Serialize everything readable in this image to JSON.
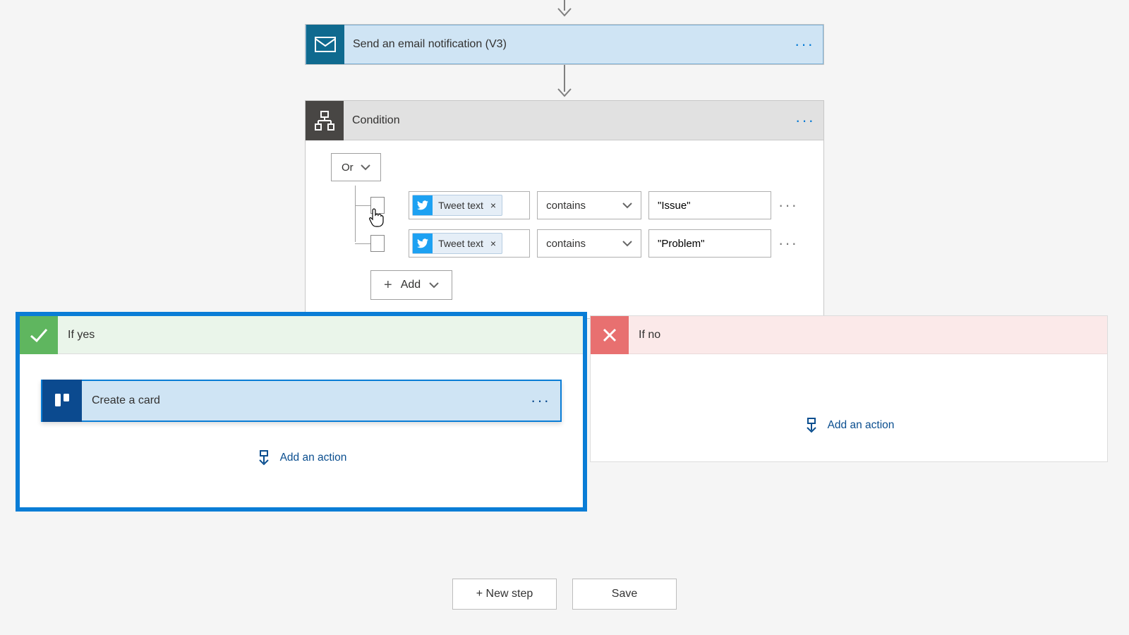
{
  "email_step": {
    "title": "Send an email notification (V3)"
  },
  "condition": {
    "title": "Condition",
    "logic": "Or",
    "rows": [
      {
        "token": "Tweet text",
        "operator": "contains",
        "value": "\"Issue\""
      },
      {
        "token": "Tweet text",
        "operator": "contains",
        "value": "\"Problem\""
      }
    ],
    "add_label": "Add"
  },
  "branches": {
    "yes": {
      "title": "If yes",
      "actions": [
        {
          "title": "Create a card"
        }
      ],
      "add_action": "Add an action"
    },
    "no": {
      "title": "If no",
      "add_action": "Add an action"
    }
  },
  "footer": {
    "new_step": "+ New step",
    "save": "Save"
  }
}
